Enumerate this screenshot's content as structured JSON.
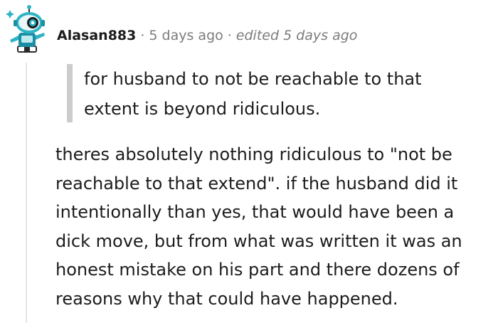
{
  "comment": {
    "author": "Alasan883",
    "separator": "·",
    "posted": "5 days ago",
    "edited": "edited 5 days ago",
    "quote": "for husband to not be reachable to that extent is beyond ridiculous.",
    "body": "theres absolutely nothing ridiculous to \"not be reachable to that extend\". if the husband did it intentionally than yes, that would have been a dick move, but from what was written it was an honest mistake on his part and there dozens of reasons why that could have happened."
  },
  "colors": {
    "text": "#1c1c1c",
    "meta": "#7c7c7c",
    "quote_bar": "#cccccc",
    "thread_line": "#e5e5e5",
    "avatar_accent": "#2fb3c5"
  },
  "icons": {
    "avatar": "snoo-avatar-icon"
  }
}
